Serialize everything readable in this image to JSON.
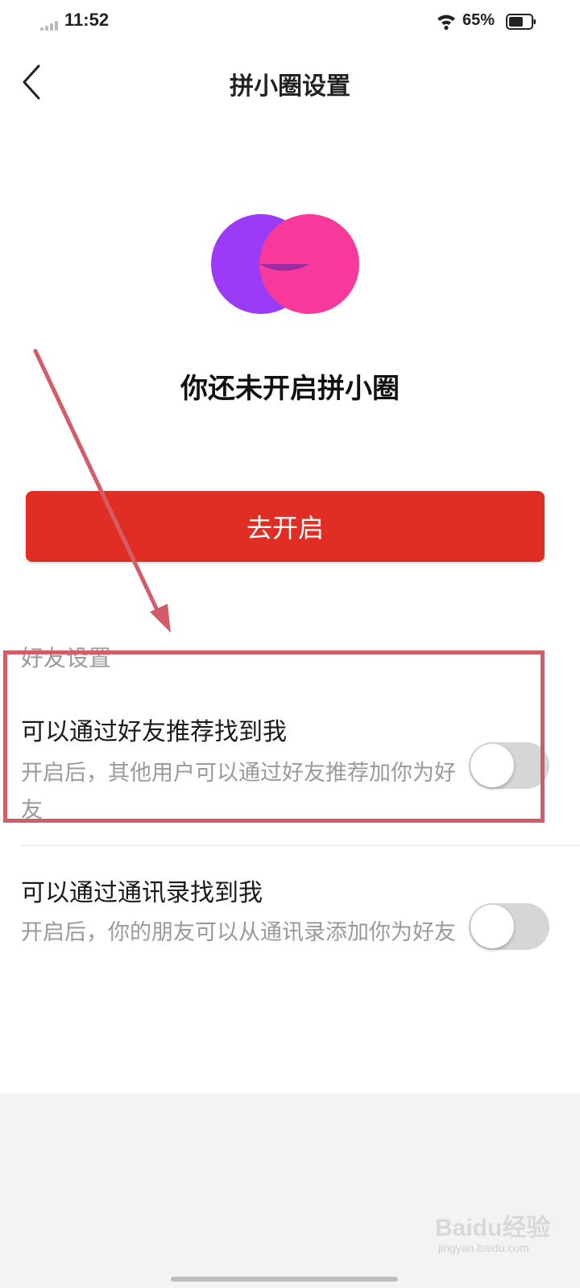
{
  "status_bar": {
    "time": "11:52",
    "battery_percent": "65%",
    "battery_level": 0.65,
    "icons": [
      "cellular-signal-icon",
      "wifi-icon",
      "battery-icon"
    ]
  },
  "header": {
    "title": "拼小圈设置",
    "back_icon": "chevron-left-icon"
  },
  "logo": {
    "icon": "pinxiaoquan-logo-icon",
    "colors": {
      "left": "#9b3bf5",
      "right": "#f7399b",
      "overlap": "#9e2aa3"
    }
  },
  "status_title": "你还未开启拼小圈",
  "open_button": {
    "label": "去开启",
    "color": "#e02e24"
  },
  "friend_settings": {
    "section_label": "好友设置",
    "items": [
      {
        "title": "可以通过好友推荐找到我",
        "description": "开启后，其他用户可以通过好友推荐加你为好友",
        "enabled": false
      },
      {
        "title": "可以通过通讯录找到我",
        "description": "开启后，你的朋友可以从通讯录添加你为好友",
        "enabled": false
      }
    ]
  },
  "annotation": {
    "color": "#d35c66"
  },
  "watermark": {
    "brand": "Baidu经验",
    "url": "jingyan.baidu.com"
  }
}
